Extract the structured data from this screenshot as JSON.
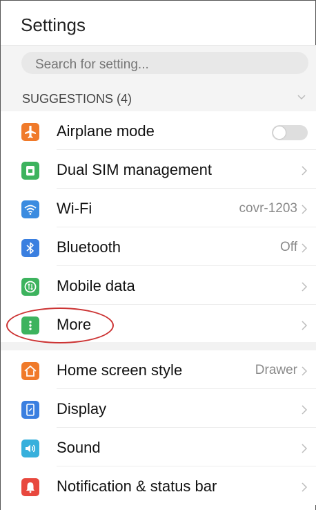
{
  "app": {
    "title": "Settings"
  },
  "search": {
    "placeholder": "Search for setting..."
  },
  "suggestions_section": {
    "label": "SUGGESTIONS (4)",
    "icon": "chevron-down-icon"
  },
  "group1": [
    {
      "id": "airplane",
      "label": "Airplane mode",
      "icon": "airplane-icon",
      "color": "#f07a2a",
      "control": "toggle",
      "toggle_on": false
    },
    {
      "id": "dual-sim",
      "label": "Dual SIM management",
      "icon": "sim-card-icon",
      "color": "#3db35e",
      "value": ""
    },
    {
      "id": "wifi",
      "label": "Wi-Fi",
      "icon": "wifi-icon",
      "color": "#3a8be0",
      "value": "covr-1203"
    },
    {
      "id": "bluetooth",
      "label": "Bluetooth",
      "icon": "bluetooth-icon",
      "color": "#3a7fe0",
      "value": "Off"
    },
    {
      "id": "mobile-data",
      "label": "Mobile data",
      "icon": "mobile-data-icon",
      "color": "#3db35e",
      "value": ""
    },
    {
      "id": "more",
      "label": "More",
      "icon": "more-dots-icon",
      "color": "#3db35e",
      "value": ""
    }
  ],
  "group2": [
    {
      "id": "home-screen-style",
      "label": "Home screen style",
      "icon": "home-icon",
      "color": "#f07a2a",
      "value": "Drawer"
    },
    {
      "id": "display",
      "label": "Display",
      "icon": "display-icon",
      "color": "#3a7fe0",
      "value": ""
    },
    {
      "id": "sound",
      "label": "Sound",
      "icon": "speaker-icon",
      "color": "#37b0dc",
      "value": ""
    },
    {
      "id": "notification",
      "label": "Notification & status bar",
      "icon": "bell-icon",
      "color": "#e8483e",
      "value": ""
    }
  ],
  "annotation": {
    "target": "more",
    "color": "#cc3333"
  }
}
